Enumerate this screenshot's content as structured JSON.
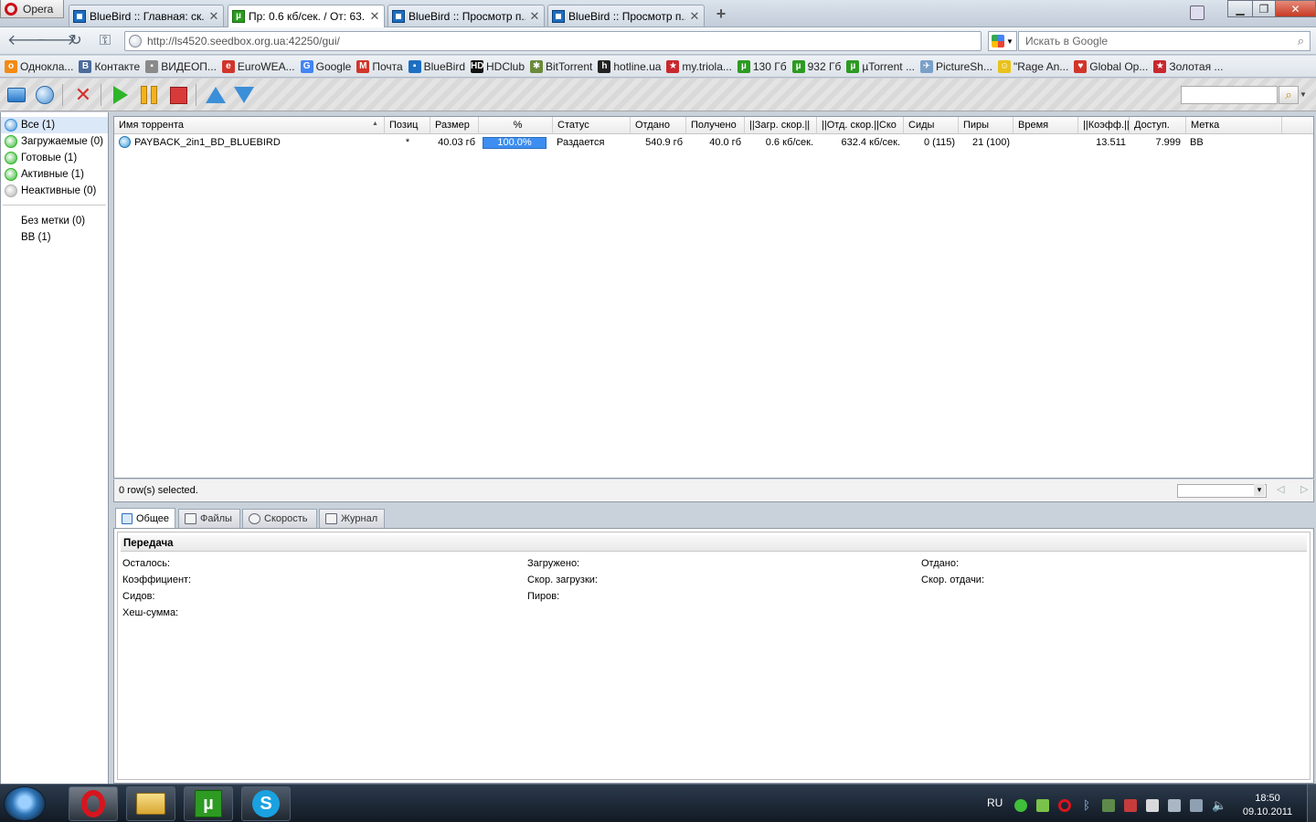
{
  "browser": {
    "menu_label": "Opera",
    "tabs": [
      {
        "label": "BlueBird :: Главная: ск...",
        "icon": "bluebird-icon"
      },
      {
        "label": "Пр: 0.6 кб/сек. / От: 63...",
        "icon": "utorrent-icon"
      },
      {
        "label": "BlueBird :: Просмотр п...",
        "icon": "bluebird-icon"
      },
      {
        "label": "BlueBird :: Просмотр п...",
        "icon": "bluebird-icon"
      }
    ],
    "url": "http://ls4520.seedbox.org.ua:42250/gui/",
    "search_placeholder": "Искать в Google",
    "bookmarks": [
      {
        "label": "Однокла...",
        "color": "#f28a14",
        "glyph": "о"
      },
      {
        "label": "Контакте",
        "color": "#4b6b9a",
        "glyph": "В"
      },
      {
        "label": "ВИДЕОП...",
        "color": "#8a8a8a",
        "glyph": "▪"
      },
      {
        "label": "EuroWEA...",
        "color": "#d0352b",
        "glyph": "e"
      },
      {
        "label": "Google",
        "color": "#4285f4",
        "glyph": "G"
      },
      {
        "label": "Почта",
        "color": "#d0352b",
        "glyph": "M"
      },
      {
        "label": "BlueBird",
        "color": "#1d6fc2",
        "glyph": "▪"
      },
      {
        "label": "HDClub",
        "color": "#111111",
        "glyph": "HD"
      },
      {
        "label": "BitTorrent",
        "color": "#6a8a3a",
        "glyph": "✱"
      },
      {
        "label": "hotline.ua",
        "color": "#222222",
        "glyph": "h"
      },
      {
        "label": "my.triola...",
        "color": "#c8282e",
        "glyph": "★"
      },
      {
        "label": "130 Гб",
        "color": "#2d9a22",
        "glyph": "µ"
      },
      {
        "label": "932 Гб",
        "color": "#2d9a22",
        "glyph": "µ"
      },
      {
        "label": "µTorrent ...",
        "color": "#2d9a22",
        "glyph": "µ"
      },
      {
        "label": "PictureSh...",
        "color": "#7aa0c8",
        "glyph": "✈"
      },
      {
        "label": "\"Rage An...",
        "color": "#e9c21c",
        "glyph": "☺"
      },
      {
        "label": "Global Op...",
        "color": "#d0352b",
        "glyph": "♥"
      },
      {
        "label": "Золотая ...",
        "color": "#c8282e",
        "glyph": "★"
      }
    ]
  },
  "sidebar": {
    "categories": [
      {
        "label": "Все (1)",
        "color": "#3a8fd8"
      },
      {
        "label": "Загружаемые (0)",
        "color": "#2fb52a"
      },
      {
        "label": "Готовые (1)",
        "color": "#2fb52a"
      },
      {
        "label": "Активные (1)",
        "color": "#2fb52a"
      },
      {
        "label": "Неактивные (0)",
        "color": "#b0b0b0"
      }
    ],
    "labels": [
      "Без метки (0)",
      "BB (1)"
    ]
  },
  "list": {
    "columns": [
      "Имя торрента",
      "Позиц",
      "Размер",
      "%",
      "Статус",
      "Отдано",
      "Получено",
      "||Загр. скор.||",
      "||Отд. скор.||Ско",
      "Сиды",
      "Пиры",
      "Время",
      "||Коэфф.||",
      "Доступ.",
      "Метка"
    ],
    "rows": [
      {
        "name": "PAYBACK_2in1_BD_BLUEBIRD",
        "position": "*",
        "size": "40.03 гб",
        "percent_label": "100.0%",
        "percent": 100,
        "status": "Раздается",
        "uploaded": "540.9 гб",
        "downloaded": "40.0 гб",
        "down_speed": "0.6 кб/сек.",
        "up_speed": "632.4 кб/сек.",
        "seeds": "0 (115)",
        "peers": "21 (100)",
        "eta": "",
        "ratio": "13.511",
        "availability": "7.999",
        "label": "BB"
      }
    ],
    "status_text": "0 row(s) selected."
  },
  "details": {
    "tabs": [
      "Общее",
      "Файлы",
      "Скорость",
      "Журнал"
    ],
    "section_title": "Передача",
    "fields": {
      "remaining": "Осталось:",
      "downloaded": "Загружено:",
      "uploaded": "Отдано:",
      "ratio": "Коэффициент:",
      "down_speed": "Скор. загрузки:",
      "up_speed": "Скор. отдачи:",
      "seeds": "Сидов:",
      "peers": "Пиров:",
      "hash": "Хеш-сумма:"
    }
  },
  "taskbar": {
    "language": "RU",
    "time": "18:50",
    "date": "09.10.2011"
  }
}
